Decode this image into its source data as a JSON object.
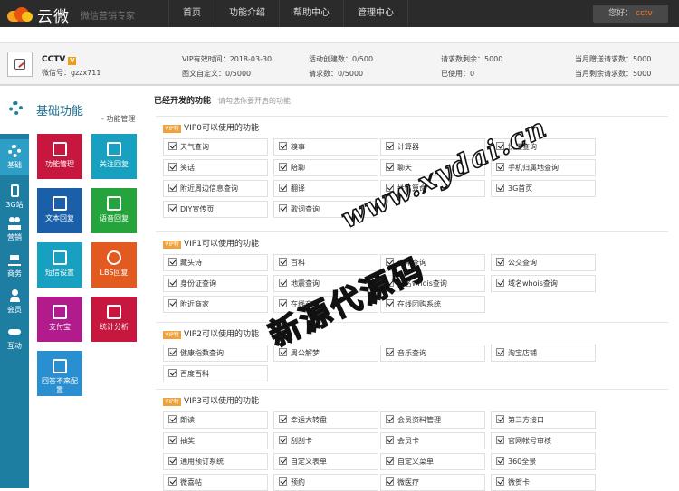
{
  "header": {
    "logo_text": "云微",
    "slogan": "微信营销专家",
    "nav": [
      "首页",
      "功能介绍",
      "帮助中心",
      "管理中心"
    ],
    "greeting_prefix": "您好：",
    "username": "cctv"
  },
  "account": {
    "name": "CCTV",
    "vip_badge": "V",
    "wechat_label": "微信号：gzzx711",
    "stats": [
      "VIP有效时间：2018-03-30",
      "图文自定义：0/5000",
      "活动创建数：0/500",
      "请求数：0/5000",
      "请求数剩余：5000",
      "已使用：0",
      "当月赠送请求数：5000",
      "当月剩余请求数：5000"
    ]
  },
  "left_nav": {
    "items": [
      {
        "label": "基础",
        "icon": "gear-icon"
      },
      {
        "label": "3G站",
        "icon": "phone-icon"
      },
      {
        "label": "营销",
        "icon": "people-icon"
      },
      {
        "label": "商务",
        "icon": "cart-icon"
      },
      {
        "label": "会员",
        "icon": "user-icon"
      },
      {
        "label": "互动",
        "icon": "handshake-icon"
      }
    ]
  },
  "panel": {
    "title": "基础功能",
    "subtitle": "- 功能管理",
    "tiles": [
      {
        "label": "功能管理",
        "color": "#c8173f",
        "icon": "list-icon"
      },
      {
        "label": "关注回复",
        "color": "#17a0bf",
        "icon": "chat-icon"
      },
      {
        "label": "文本回复",
        "color": "#1a5fa8",
        "icon": "document-icon"
      },
      {
        "label": "语音回复",
        "color": "#25a33c",
        "icon": "microphone-icon"
      },
      {
        "label": "短信设置",
        "color": "#17a0bf",
        "icon": "message-icon"
      },
      {
        "label": "LBS回复",
        "color": "#e25a20",
        "icon": "compass-icon"
      },
      {
        "label": "支付宝",
        "color": "#b11b8c",
        "icon": "image-icon"
      },
      {
        "label": "统计分析",
        "color": "#c8173f",
        "icon": "chart-icon"
      },
      {
        "label": "回答不来配置",
        "color": "#2a8fd0",
        "icon": "comment-icon"
      }
    ]
  },
  "content": {
    "title": "已经开发的功能",
    "subtitle": "请勾选你要开启的功能",
    "tag": "VIP特",
    "sections": [
      {
        "title": "VIP0可以使用的功能",
        "items": [
          "天气查询",
          "糗事",
          "计算器",
          "快递查询",
          "笑话",
          "陪聊",
          "聊天",
          "手机归属地查询",
          "附近周边信息查询",
          "翻译",
          "姓名算命",
          "3G首页",
          "DIY宣传页",
          "歌词查询"
        ]
      },
      {
        "title": "VIP1可以使用的功能",
        "items": [
          "藏头诗",
          "百科",
          "火车查询",
          "公交查询",
          "身份证查询",
          "地震查询",
          "域名whois查询",
          "域名whois查询",
          "附近商家",
          "在线商城",
          "在线团购系统"
        ]
      },
      {
        "title": "VIP2可以使用的功能",
        "items": [
          "健康指数查询",
          "周公解梦",
          "音乐查询",
          "淘宝店铺",
          "百度百科"
        ]
      },
      {
        "title": "VIP3可以使用的功能",
        "items": [
          "朗读",
          "幸运大转盘",
          "会员资料管理",
          "第三方接口",
          "抽奖",
          "刮刮卡",
          "会员卡",
          "官网帐号审核",
          "通用预订系统",
          "自定义表单",
          "自定义菜单",
          "360全景",
          "微喜帖",
          "预约",
          "微医疗",
          "微贺卡"
        ]
      }
    ]
  },
  "watermark": {
    "url": "www.xydai.cn",
    "text": "新源代源码"
  }
}
